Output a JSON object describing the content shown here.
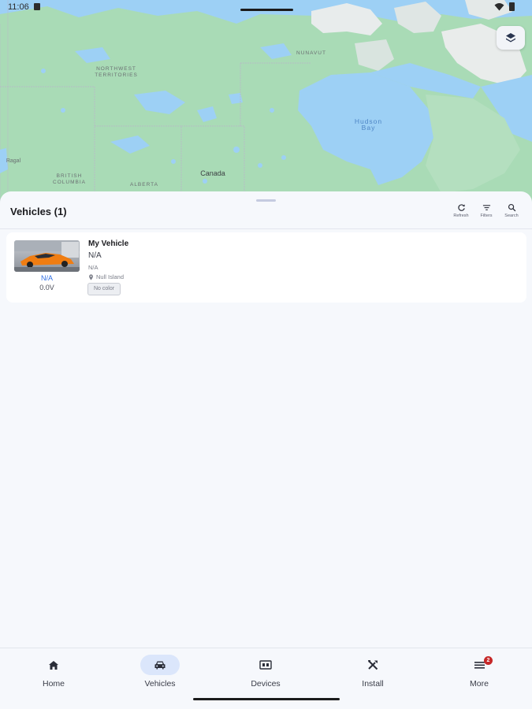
{
  "status_bar": {
    "time": "11:06"
  },
  "map": {
    "labels": {
      "northwest_territories": "NORTHWEST TERRITORIES",
      "nunavut": "NUNAVUT",
      "hudson_bay": "Hudson Bay",
      "canada": "Canada",
      "british_columbia": "BRITISH COLUMBIA",
      "alberta": "ALBERTA",
      "alaska_partial": "Ragal"
    }
  },
  "sheet": {
    "title": "Vehicles (1)",
    "actions": [
      {
        "label": "Refresh",
        "icon": "refresh-icon"
      },
      {
        "label": "Filters",
        "icon": "filter-icon"
      },
      {
        "label": "Search",
        "icon": "search-icon"
      }
    ]
  },
  "vehicles": [
    {
      "name": "My Vehicle",
      "plate": "N/A",
      "subtitle": "N/A",
      "location": "Null Island",
      "color_chip": "No color",
      "status": "N/A",
      "voltage": "0.0V"
    }
  ],
  "nav": {
    "items": [
      {
        "label": "Home",
        "icon": "home-icon"
      },
      {
        "label": "Vehicles",
        "icon": "car-icon",
        "active": true
      },
      {
        "label": "Devices",
        "icon": "device-icon"
      },
      {
        "label": "Install",
        "icon": "tools-icon"
      },
      {
        "label": "More",
        "icon": "menu-icon",
        "badge": "2"
      }
    ]
  },
  "colors": {
    "accent": "#2f6fe4",
    "active_nav_bg": "#dbe6fb",
    "water": "#9dd0f5",
    "land": "#a8dab5",
    "badge": "#c62828"
  }
}
